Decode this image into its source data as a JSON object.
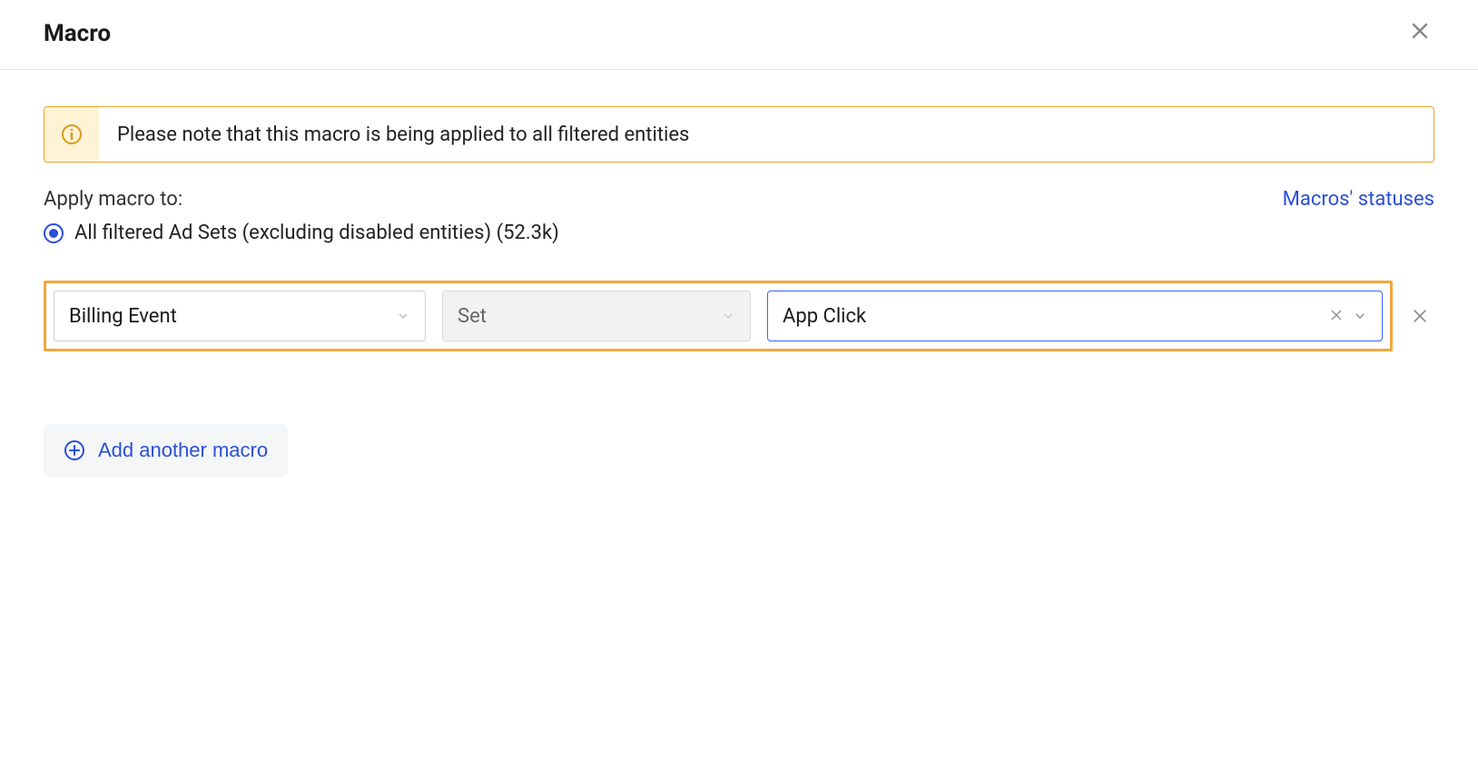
{
  "header": {
    "title": "Macro"
  },
  "banner": {
    "text": "Please note that this macro is being applied to all filtered entities"
  },
  "apply": {
    "label": "Apply macro to:",
    "statuses_link": "Macros' statuses",
    "radio_label": "All filtered Ad Sets (excluding disabled entities) (52.3k)"
  },
  "macro_row": {
    "field": "Billing Event",
    "operation": "Set",
    "value": "App Click"
  },
  "add_button": "Add another macro"
}
